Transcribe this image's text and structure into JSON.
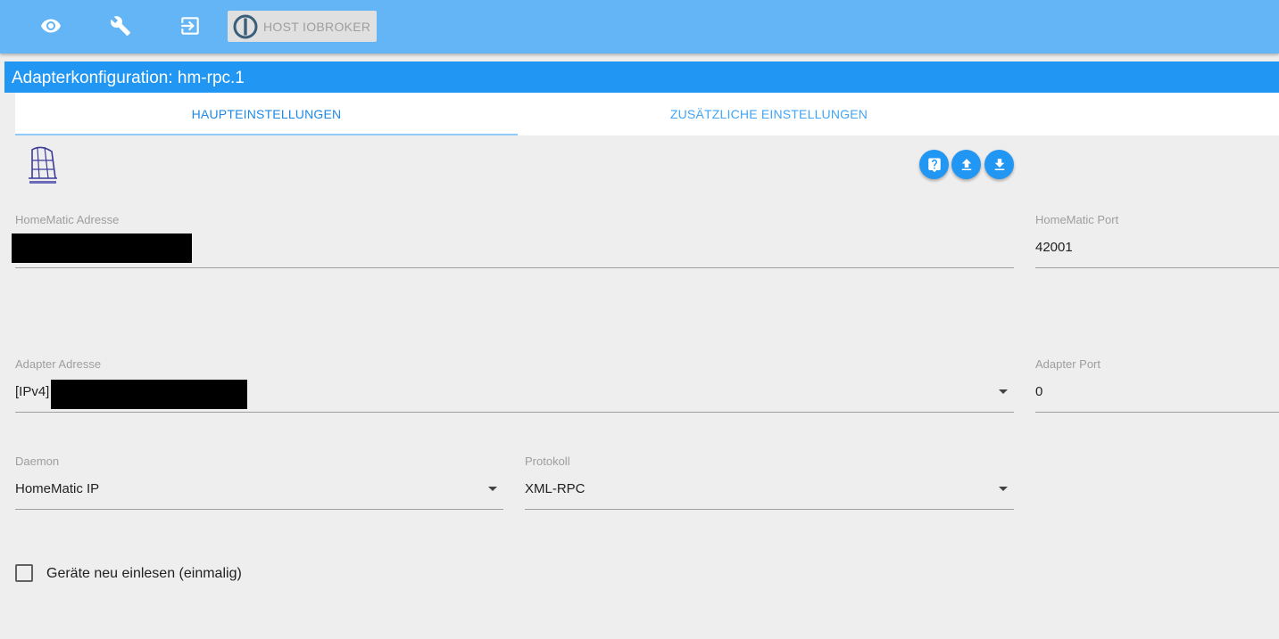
{
  "topbar": {
    "icons": [
      "eye-icon",
      "wrench-icon",
      "logout-icon"
    ],
    "host_button_label": "HOST IOBROKER"
  },
  "dialog": {
    "title": "Adapterkonfiguration: hm-rpc.1"
  },
  "tabs": [
    {
      "label": "HAUPTEINSTELLUNGEN",
      "active": true
    },
    {
      "label": "ZUSÄTZLICHE EINSTELLUNGEN",
      "active": false
    }
  ],
  "toolbar": {
    "icons": [
      "help-icon",
      "upload-icon",
      "download-icon"
    ]
  },
  "fields": {
    "homematic_address": {
      "label": "HomeMatic Adresse",
      "value": ""
    },
    "homematic_port": {
      "label": "HomeMatic Port",
      "value": "42001"
    },
    "adapter_address": {
      "label": "Adapter Adresse",
      "value": "[IPv4]"
    },
    "adapter_port": {
      "label": "Adapter Port",
      "value": "0"
    },
    "daemon": {
      "label": "Daemon",
      "value": "HomeMatic IP"
    },
    "protocol": {
      "label": "Protokoll",
      "value": "XML-RPC"
    }
  },
  "checkbox": {
    "label": "Geräte neu einlesen (einmalig)",
    "checked": false
  },
  "colors": {
    "topbar": "#64b5f6",
    "titlebar": "#2196f3",
    "accent": "#1e88e5",
    "background": "#eeeeee"
  }
}
